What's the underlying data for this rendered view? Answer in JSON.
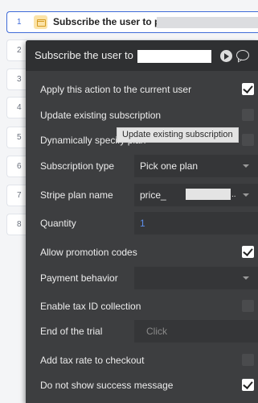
{
  "steps": [
    {
      "num": "1",
      "title": "Subscribe the user to price_"
    },
    {
      "num": "2"
    },
    {
      "num": "3"
    },
    {
      "num": "4"
    },
    {
      "num": "5"
    },
    {
      "num": "6"
    },
    {
      "num": "7"
    },
    {
      "num": "8"
    }
  ],
  "panel": {
    "title": "Subscribe the user to",
    "apply_current_user": {
      "label": "Apply this action to the current user",
      "checked": true
    },
    "update_existing": {
      "label": "Update existing subscription",
      "checked": false
    },
    "dynamic_plan": {
      "label": "Dynamically specify plan",
      "checked": false
    },
    "subscription_type": {
      "label": "Subscription type",
      "value": "Pick one plan"
    },
    "stripe_plan": {
      "label": "Stripe plan name",
      "value": "price_",
      "suffix": ".."
    },
    "quantity": {
      "label": "Quantity",
      "value": "1"
    },
    "promotion_codes": {
      "label": "Allow promotion codes",
      "checked": true
    },
    "payment_behavior": {
      "label": "Payment behavior",
      "value": ""
    },
    "tax_id": {
      "label": "Enable tax ID collection",
      "checked": false
    },
    "trial_end": {
      "label": "End of the trial",
      "placeholder": "Click"
    },
    "tax_rate": {
      "label": "Add tax rate to checkout",
      "checked": false
    },
    "hide_success": {
      "label": "Do not show success message",
      "checked": true
    }
  },
  "tooltip": "Update existing subscription"
}
